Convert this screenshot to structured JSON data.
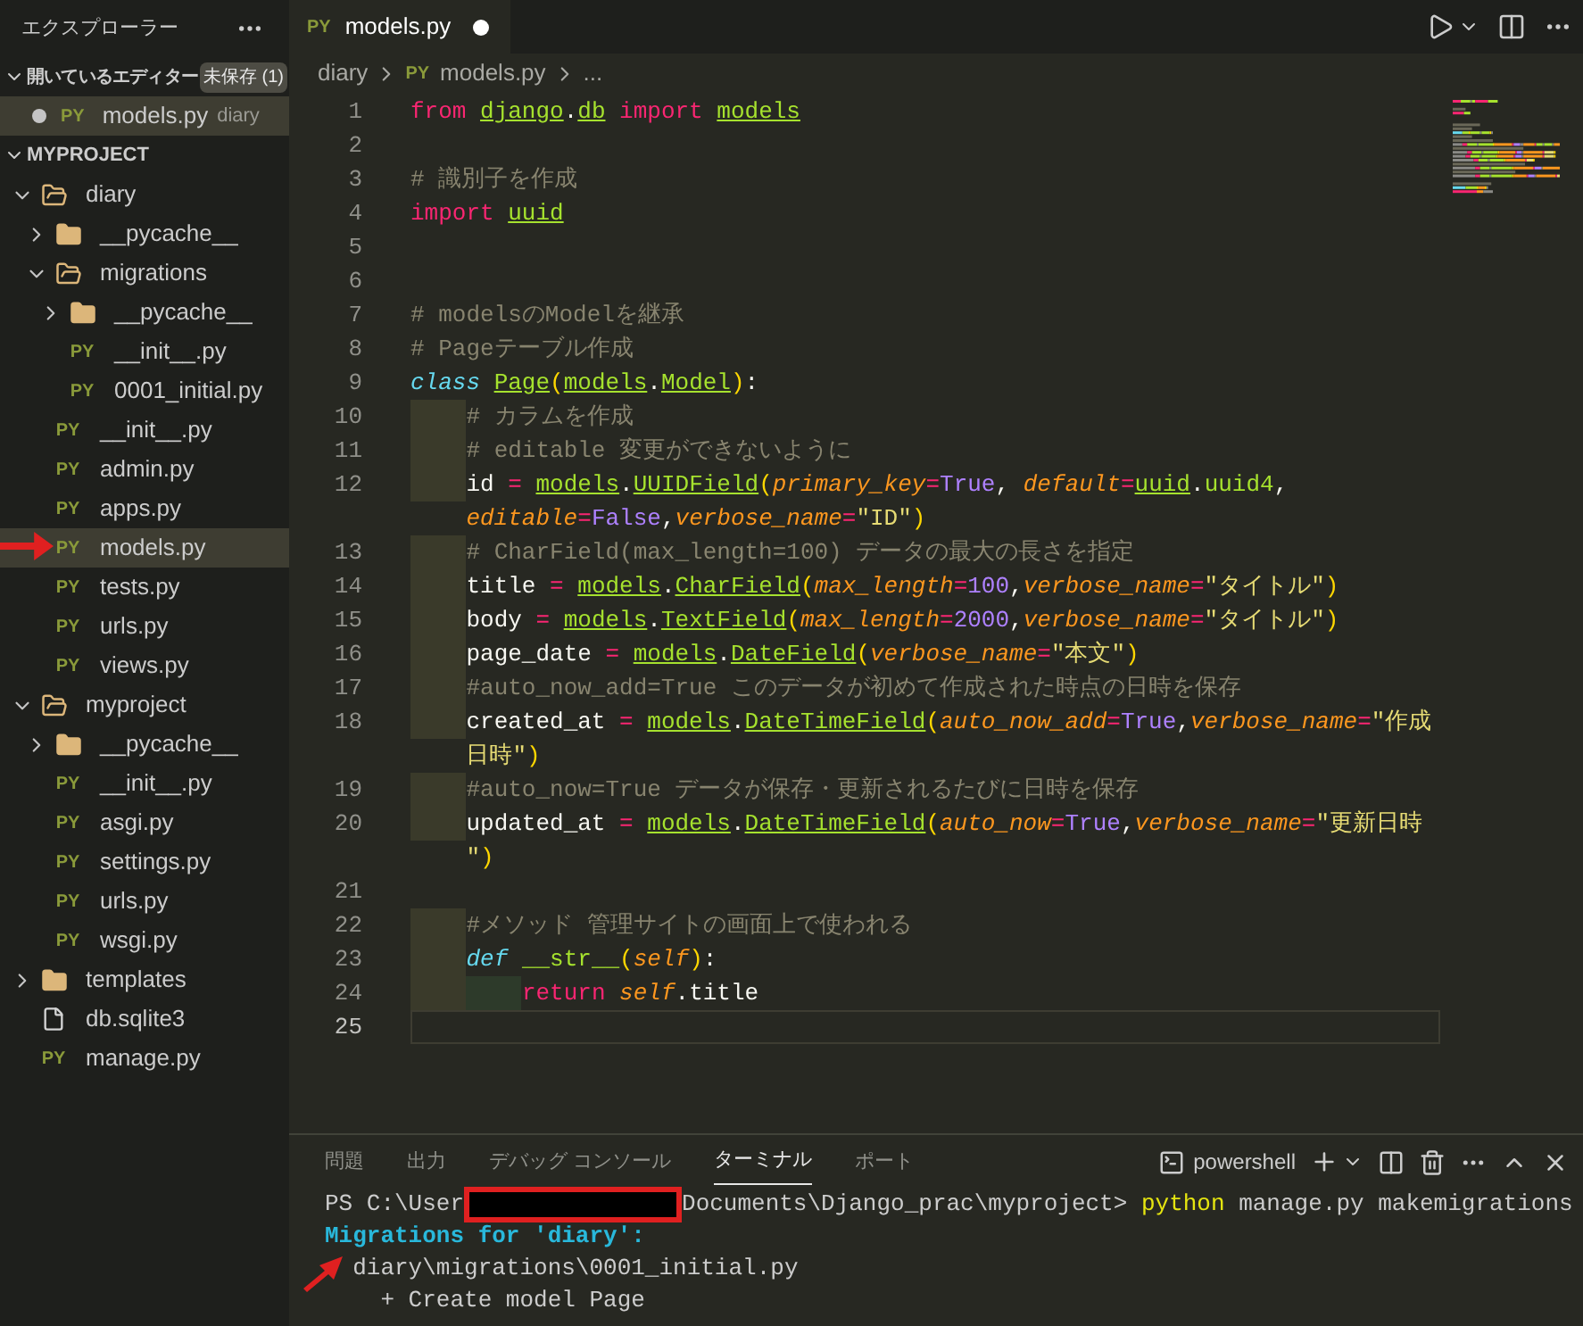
{
  "sidebar": {
    "title": "エクスプローラー",
    "open_editors": {
      "label": "開いているエディター",
      "expanded": true,
      "badge": "未保存 (1)",
      "items": [
        {
          "icon_text": "PY",
          "name": "models.py",
          "folder": "diary",
          "modified": true,
          "selected": true
        }
      ]
    },
    "project": {
      "label": "MYPROJECT",
      "expanded": true,
      "tree": [
        {
          "kind": "folder",
          "name": "diary",
          "expanded": true,
          "selected": false,
          "children": [
            {
              "kind": "folder",
              "name": "__pycache__",
              "expanded": false,
              "selected": false
            },
            {
              "kind": "folder",
              "name": "migrations",
              "expanded": true,
              "selected": false,
              "children": [
                {
                  "kind": "folder",
                  "name": "__pycache__",
                  "expanded": false,
                  "selected": false
                },
                {
                  "kind": "py",
                  "icon_text": "PY",
                  "name": "__init__.py",
                  "selected": false
                },
                {
                  "kind": "py",
                  "icon_text": "PY",
                  "name": "0001_initial.py",
                  "selected": false
                }
              ]
            },
            {
              "kind": "py",
              "icon_text": "PY",
              "name": "__init__.py",
              "selected": false
            },
            {
              "kind": "py",
              "icon_text": "PY",
              "name": "admin.py",
              "selected": false
            },
            {
              "kind": "py",
              "icon_text": "PY",
              "name": "apps.py",
              "selected": false
            },
            {
              "kind": "py",
              "icon_text": "PY",
              "name": "models.py",
              "selected": true
            },
            {
              "kind": "py",
              "icon_text": "PY",
              "name": "tests.py",
              "selected": false
            },
            {
              "kind": "py",
              "icon_text": "PY",
              "name": "urls.py",
              "selected": false
            },
            {
              "kind": "py",
              "icon_text": "PY",
              "name": "views.py",
              "selected": false
            }
          ]
        },
        {
          "kind": "folder",
          "name": "myproject",
          "expanded": true,
          "selected": false,
          "children": [
            {
              "kind": "folder",
              "name": "__pycache__",
              "expanded": false,
              "selected": false
            },
            {
              "kind": "py",
              "icon_text": "PY",
              "name": "__init__.py",
              "selected": false
            },
            {
              "kind": "py",
              "icon_text": "PY",
              "name": "asgi.py",
              "selected": false
            },
            {
              "kind": "py",
              "icon_text": "PY",
              "name": "settings.py",
              "selected": false
            },
            {
              "kind": "py",
              "icon_text": "PY",
              "name": "urls.py",
              "selected": false
            },
            {
              "kind": "py",
              "icon_text": "PY",
              "name": "wsgi.py",
              "selected": false
            }
          ]
        },
        {
          "kind": "folder",
          "name": "templates",
          "expanded": false,
          "selected": false
        },
        {
          "kind": "file",
          "name": "db.sqlite3",
          "selected": false
        },
        {
          "kind": "py",
          "icon_text": "PY",
          "name": "manage.py",
          "selected": false
        }
      ]
    }
  },
  "editor": {
    "tabs": [
      {
        "icon_text": "PY",
        "label": "models.py",
        "modified": true,
        "selected": true
      }
    ],
    "breadcrumb": [
      {
        "label": "diary"
      },
      {
        "icon_text": "PY",
        "label": "models.py"
      },
      {
        "label": "..."
      }
    ],
    "lines": [
      {
        "number": "1",
        "current": false,
        "tokens": [
          {
            "text": "from ",
            "kind": "kw"
          },
          {
            "text": "django",
            "kind": "name"
          },
          {
            "text": ".",
            "kind": "plain"
          },
          {
            "text": "db",
            "kind": "name"
          },
          {
            "text": " import ",
            "kind": "kw"
          },
          {
            "text": "models",
            "kind": "name"
          }
        ]
      },
      {
        "number": "2",
        "current": false
      },
      {
        "number": "3",
        "current": false,
        "tokens": [
          {
            "text": "# 識別子を作成",
            "kind": "comment"
          }
        ]
      },
      {
        "number": "4",
        "current": false,
        "tokens": [
          {
            "text": "import ",
            "kind": "kw"
          },
          {
            "text": "uuid",
            "kind": "name"
          }
        ]
      },
      {
        "number": "5",
        "current": false
      },
      {
        "number": "6",
        "current": false
      },
      {
        "number": "7",
        "current": false,
        "tokens": [
          {
            "text": "# modelsのModelを継承",
            "kind": "comment"
          }
        ]
      },
      {
        "number": "8",
        "current": false,
        "tokens": [
          {
            "text": "# Pageテーブル作成",
            "kind": "comment"
          }
        ]
      },
      {
        "number": "9",
        "current": false,
        "tokens": [
          {
            "text": "class ",
            "kind": "storage"
          },
          {
            "text": "Page",
            "kind": "name"
          },
          {
            "text": "(",
            "kind": "bracket"
          },
          {
            "text": "models",
            "kind": "name"
          },
          {
            "text": ".",
            "kind": "plain"
          },
          {
            "text": "Model",
            "kind": "name"
          },
          {
            "text": ")",
            "kind": "bracket"
          },
          {
            "text": ":",
            "kind": "plain"
          }
        ]
      },
      {
        "number": "10",
        "current": false,
        "tokens": [
          {
            "text": "    # カラムを作成",
            "kind": "comment"
          }
        ]
      },
      {
        "number": "11",
        "current": false,
        "tokens": [
          {
            "text": "    # editable 変更ができないように",
            "kind": "comment"
          }
        ]
      },
      {
        "number": "12",
        "current": false,
        "tokens": [
          {
            "text": "    id",
            "kind": "plain"
          },
          {
            "text": " = ",
            "kind": "op"
          },
          {
            "text": "models",
            "kind": "name"
          },
          {
            "text": ".",
            "kind": "plain"
          },
          {
            "text": "UUIDField",
            "kind": "name"
          },
          {
            "text": "(",
            "kind": "bracket"
          },
          {
            "text": "primary_key",
            "kind": "param"
          },
          {
            "text": "=",
            "kind": "op"
          },
          {
            "text": "True",
            "kind": "const"
          },
          {
            "text": ", ",
            "kind": "plain"
          },
          {
            "text": "default",
            "kind": "param"
          },
          {
            "text": "=",
            "kind": "op"
          },
          {
            "text": "uuid",
            "kind": "name"
          },
          {
            "text": ".",
            "kind": "plain"
          },
          {
            "text": "uuid4",
            "kind": "func"
          },
          {
            "text": ",",
            "kind": "plain"
          },
          {
            "text": "editable",
            "kind": "param",
            "wrapped": true
          },
          {
            "text": "=",
            "kind": "op"
          },
          {
            "text": "False",
            "kind": "const"
          },
          {
            "text": ",",
            "kind": "plain"
          },
          {
            "text": "verbose_name",
            "kind": "param"
          },
          {
            "text": "=",
            "kind": "op"
          },
          {
            "text": "\"ID\"",
            "kind": "str"
          },
          {
            "text": ")",
            "kind": "bracket"
          }
        ]
      },
      {
        "number": "13",
        "current": false,
        "tokens": [
          {
            "text": "    # CharField(max_length=100) データの最大の長さを指定",
            "kind": "comment"
          }
        ]
      },
      {
        "number": "14",
        "current": false,
        "tokens": [
          {
            "text": "    title",
            "kind": "plain"
          },
          {
            "text": " = ",
            "kind": "op"
          },
          {
            "text": "models",
            "kind": "name"
          },
          {
            "text": ".",
            "kind": "plain"
          },
          {
            "text": "CharField",
            "kind": "name"
          },
          {
            "text": "(",
            "kind": "bracket"
          },
          {
            "text": "max_length",
            "kind": "param"
          },
          {
            "text": "=",
            "kind": "op"
          },
          {
            "text": "100",
            "kind": "const"
          },
          {
            "text": ",",
            "kind": "plain"
          },
          {
            "text": "verbose_name",
            "kind": "param"
          },
          {
            "text": "=",
            "kind": "op"
          },
          {
            "text": "\"タイトル\"",
            "kind": "str"
          },
          {
            "text": ")",
            "kind": "bracket"
          }
        ]
      },
      {
        "number": "15",
        "current": false,
        "tokens": [
          {
            "text": "    body",
            "kind": "plain"
          },
          {
            "text": " = ",
            "kind": "op"
          },
          {
            "text": "models",
            "kind": "name"
          },
          {
            "text": ".",
            "kind": "plain"
          },
          {
            "text": "TextField",
            "kind": "name"
          },
          {
            "text": "(",
            "kind": "bracket"
          },
          {
            "text": "max_length",
            "kind": "param"
          },
          {
            "text": "=",
            "kind": "op"
          },
          {
            "text": "2000",
            "kind": "const"
          },
          {
            "text": ",",
            "kind": "plain"
          },
          {
            "text": "verbose_name",
            "kind": "param"
          },
          {
            "text": "=",
            "kind": "op"
          },
          {
            "text": "\"タイトル\"",
            "kind": "str"
          },
          {
            "text": ")",
            "kind": "bracket"
          }
        ]
      },
      {
        "number": "16",
        "current": false,
        "tokens": [
          {
            "text": "    page_date",
            "kind": "plain"
          },
          {
            "text": " = ",
            "kind": "op"
          },
          {
            "text": "models",
            "kind": "name"
          },
          {
            "text": ".",
            "kind": "plain"
          },
          {
            "text": "DateField",
            "kind": "name"
          },
          {
            "text": "(",
            "kind": "bracket"
          },
          {
            "text": "verbose_name",
            "kind": "param"
          },
          {
            "text": "=",
            "kind": "op"
          },
          {
            "text": "\"本文\"",
            "kind": "str"
          },
          {
            "text": ")",
            "kind": "bracket"
          }
        ]
      },
      {
        "number": "17",
        "current": false,
        "tokens": [
          {
            "text": "    #auto_now_add=True このデータが初めて作成された時点の日時を保存",
            "kind": "comment"
          }
        ]
      },
      {
        "number": "18",
        "current": false,
        "tokens": [
          {
            "text": "    created_at",
            "kind": "plain"
          },
          {
            "text": " = ",
            "kind": "op"
          },
          {
            "text": "models",
            "kind": "name"
          },
          {
            "text": ".",
            "kind": "plain"
          },
          {
            "text": "DateTimeField",
            "kind": "name"
          },
          {
            "text": "(",
            "kind": "bracket"
          },
          {
            "text": "auto_now_add",
            "kind": "param"
          },
          {
            "text": "=",
            "kind": "op"
          },
          {
            "text": "True",
            "kind": "const"
          },
          {
            "text": ",",
            "kind": "plain"
          },
          {
            "text": "verbose_name",
            "kind": "param"
          },
          {
            "text": "=",
            "kind": "op"
          },
          {
            "text": "\"作成",
            "kind": "str"
          },
          {
            "text": "日時\"",
            "kind": "str",
            "wrapped": true
          },
          {
            "text": ")",
            "kind": "bracket"
          }
        ]
      },
      {
        "number": "19",
        "current": false,
        "tokens": [
          {
            "text": "    #auto_now=True データが保存・更新されるたびに日時を保存",
            "kind": "comment"
          }
        ]
      },
      {
        "number": "20",
        "current": false,
        "tokens": [
          {
            "text": "    updated_at",
            "kind": "plain"
          },
          {
            "text": " = ",
            "kind": "op"
          },
          {
            "text": "models",
            "kind": "name"
          },
          {
            "text": ".",
            "kind": "plain"
          },
          {
            "text": "DateTimeField",
            "kind": "name"
          },
          {
            "text": "(",
            "kind": "bracket"
          },
          {
            "text": "auto_now",
            "kind": "param"
          },
          {
            "text": "=",
            "kind": "op"
          },
          {
            "text": "True",
            "kind": "const"
          },
          {
            "text": ",",
            "kind": "plain"
          },
          {
            "text": "verbose_name",
            "kind": "param"
          },
          {
            "text": "=",
            "kind": "op"
          },
          {
            "text": "\"更新日時",
            "kind": "str"
          },
          {
            "text": "\"",
            "kind": "str",
            "wrapped": true
          },
          {
            "text": ")",
            "kind": "bracket"
          }
        ]
      },
      {
        "number": "21",
        "current": false
      },
      {
        "number": "22",
        "current": false,
        "tokens": [
          {
            "text": "    #メソッド 管理サイトの画面上で使われる",
            "kind": "comment"
          }
        ]
      },
      {
        "number": "23",
        "current": false,
        "tokens": [
          {
            "text": "    def ",
            "kind": "storage"
          },
          {
            "text": "__str__",
            "kind": "func"
          },
          {
            "text": "(",
            "kind": "bracket"
          },
          {
            "text": "self",
            "kind": "param"
          },
          {
            "text": ")",
            "kind": "bracket"
          },
          {
            "text": ":",
            "kind": "plain"
          }
        ]
      },
      {
        "number": "24",
        "current": false,
        "tokens": [
          {
            "text": "        return ",
            "kind": "kw"
          },
          {
            "text": "self",
            "kind": "param"
          },
          {
            "text": ".title",
            "kind": "plain"
          }
        ]
      },
      {
        "number": "25",
        "current": true
      }
    ]
  },
  "panel": {
    "tabs": [
      {
        "label": "問題",
        "selected": false
      },
      {
        "label": "出力",
        "selected": false
      },
      {
        "label": "デバッグ コンソール",
        "selected": false
      },
      {
        "label": "ターミナル",
        "selected": true
      },
      {
        "label": "ポート",
        "selected": false
      }
    ],
    "shell": "powershell",
    "terminal": [
      {
        "segments": [
          {
            "text": "PS C:\\User",
            "kind": "plain"
          },
          {
            "kind": "redacted"
          },
          {
            "text": "Documents\\Django_prac\\myproject> ",
            "kind": "plain"
          },
          {
            "text": "python",
            "kind": "command"
          },
          {
            "text": " manage.py makemigrations",
            "kind": "plain"
          }
        ]
      },
      {
        "segments": [
          {
            "text": "Migrations for 'diary':",
            "kind": "heading"
          }
        ]
      },
      {
        "segments": [
          {
            "text": "  diary\\migrations\\0001_initial.py",
            "kind": "plain"
          }
        ]
      },
      {
        "segments": [
          {
            "text": "    + Create model Page",
            "kind": "plain"
          }
        ]
      }
    ]
  }
}
